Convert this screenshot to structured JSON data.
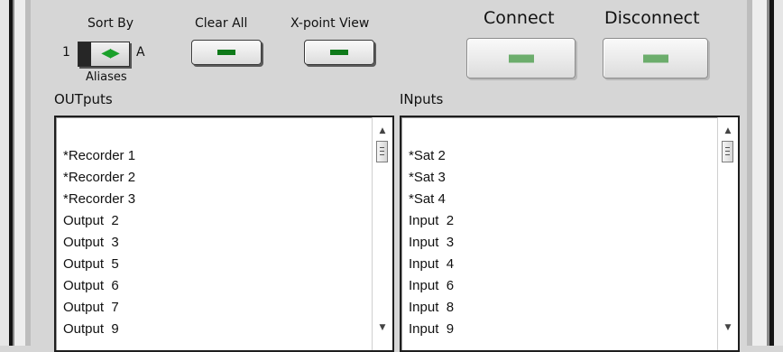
{
  "sort": {
    "title": "Sort By",
    "left_value": "1",
    "right_value": "A",
    "sublabel": "Aliases",
    "arrows": "◀▶"
  },
  "clear_all": {
    "label": "Clear All"
  },
  "xpoint_view": {
    "label": "X-point View"
  },
  "connect": {
    "label": "Connect"
  },
  "disconnect": {
    "label": "Disconnect"
  },
  "outputs": {
    "title": "OUTputs",
    "items": [
      "*Recorder 1",
      "*Recorder 2",
      "*Recorder 3",
      "Output  2",
      "Output  3",
      "Output  5",
      "Output  6",
      "Output  7",
      "Output  9"
    ]
  },
  "inputs": {
    "title": "INputs",
    "items": [
      "*Sat 2",
      "*Sat 3",
      "*Sat 4",
      "Input  2",
      "Input  3",
      "Input  4",
      "Input  6",
      "Input  8",
      "Input  9"
    ]
  },
  "colors": {
    "indicator_dark": "#0f7a1a",
    "indicator_light": "#6cad6c",
    "toggle_arrows": "#1aa02a"
  },
  "icons": {
    "scroll_up": "▲",
    "scroll_down": "▼"
  }
}
